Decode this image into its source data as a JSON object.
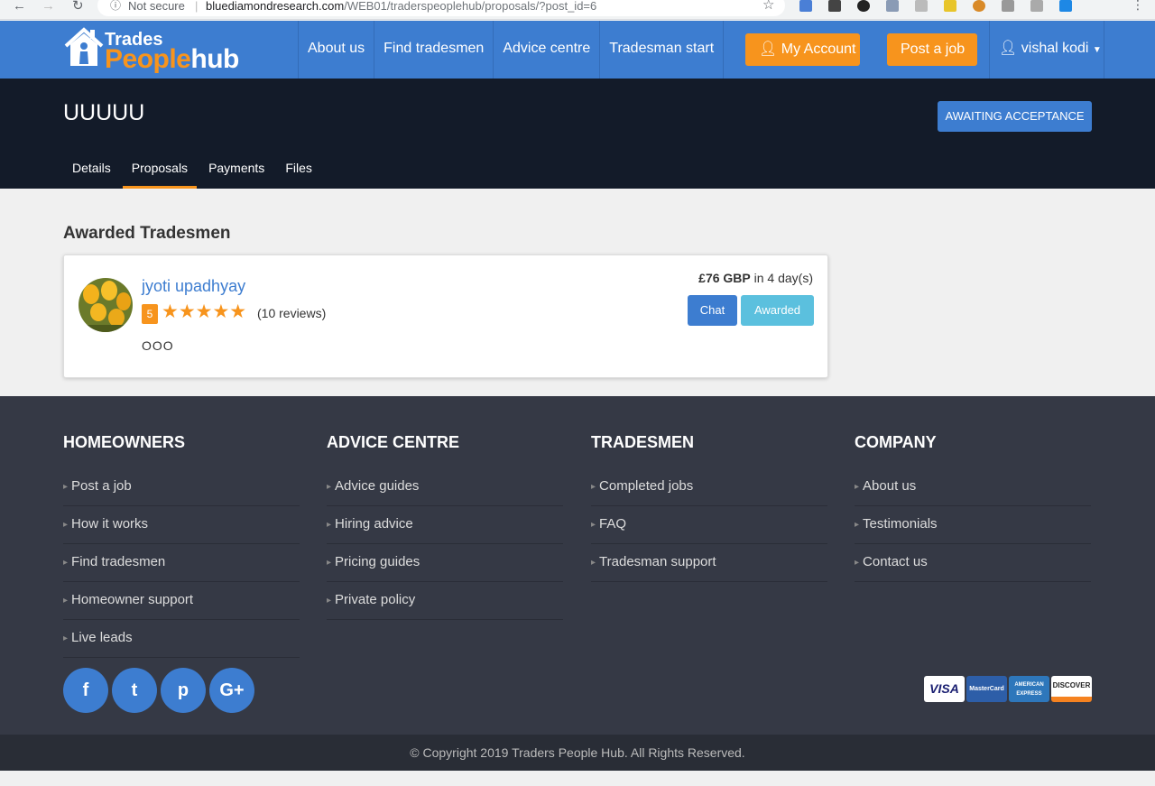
{
  "browser": {
    "security": "Not secure",
    "separator": "|",
    "url_host": "bluediamondresearch.com",
    "url_path": "/WEB01/traderspeoplehub/proposals/?post_id=6",
    "icons": [
      "back-arrow-icon",
      "forward-arrow-icon",
      "reload-icon",
      "info-icon",
      "star-icon",
      "more-vertical-icon"
    ]
  },
  "header": {
    "logo_top": "Trades",
    "logo_people": "People",
    "logo_hub": "hub",
    "nav": [
      "About us",
      "Find tradesmen",
      "Advice centre",
      "Tradesman start"
    ],
    "my_account": "My Account",
    "post_job": "Post a job",
    "user_name": "vishal kodi",
    "user_icon": "user-icon",
    "caret_icon": "caret-down-icon"
  },
  "job": {
    "title": "UUUUU",
    "status": "Awaiting Acceptance",
    "tabs": [
      "Details",
      "Proposals",
      "Payments",
      "Files"
    ],
    "active_tab": "Proposals"
  },
  "main": {
    "section_title": "Awarded Tradesmen",
    "proposal": {
      "name": "jyoti upadhyay",
      "rating": "5",
      "stars": "★★★★★",
      "reviews": "(10 reviews)",
      "message": "OOO",
      "price": "£76 GBP",
      "duration": "in 4 day(s)",
      "chat_label": "Chat",
      "awarded_label": "Awarded"
    }
  },
  "footer": {
    "columns": [
      {
        "heading": "HOMEOWNERS",
        "links": [
          "Post a job",
          "How it works",
          "Find tradesmen",
          "Homeowner support",
          "Live leads"
        ]
      },
      {
        "heading": "ADVICE CENTRE",
        "links": [
          "Advice guides",
          "Hiring advice",
          "Pricing guides",
          "Private policy"
        ]
      },
      {
        "heading": "TRADESMEN",
        "links": [
          "Completed jobs",
          "FAQ",
          "Tradesman support"
        ]
      },
      {
        "heading": "COMPANY",
        "links": [
          "About us",
          "Testimonials",
          "Contact us"
        ]
      }
    ],
    "social": [
      "f",
      "t",
      "p",
      "G+"
    ],
    "payment_cards": [
      "VISA",
      "MasterCard",
      "AMERICAN EXPRESS",
      "DISCOVER"
    ],
    "copyright": "© Copyright 2019 Traders People Hub. All Rights Reserved."
  },
  "colors": {
    "brand_blue": "#3d7dd0",
    "brand_orange": "#f7941d",
    "banner_dark": "#131b29",
    "footer_dark": "#353945",
    "awarded_teal": "#5bc0de"
  }
}
